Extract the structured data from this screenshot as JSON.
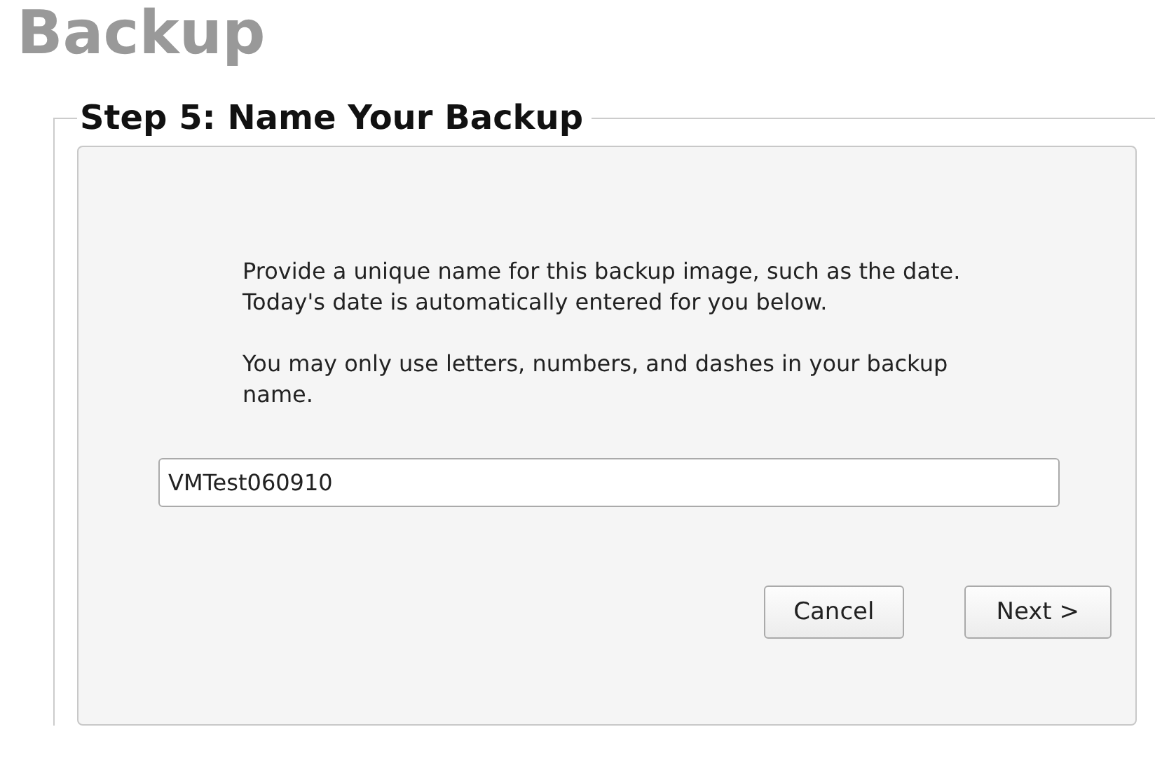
{
  "title": "Backup",
  "step": {
    "legend": "Step 5: Name Your Backup",
    "paragraphs": [
      "Provide a unique name for this backup image, such as the date.  Today's date is automatically entered for you below.",
      "You may only use letters, numbers, and dashes in your backup name."
    ],
    "name_field": {
      "value": "VMTest060910"
    },
    "buttons": [
      "Cancel",
      "Next >"
    ]
  }
}
